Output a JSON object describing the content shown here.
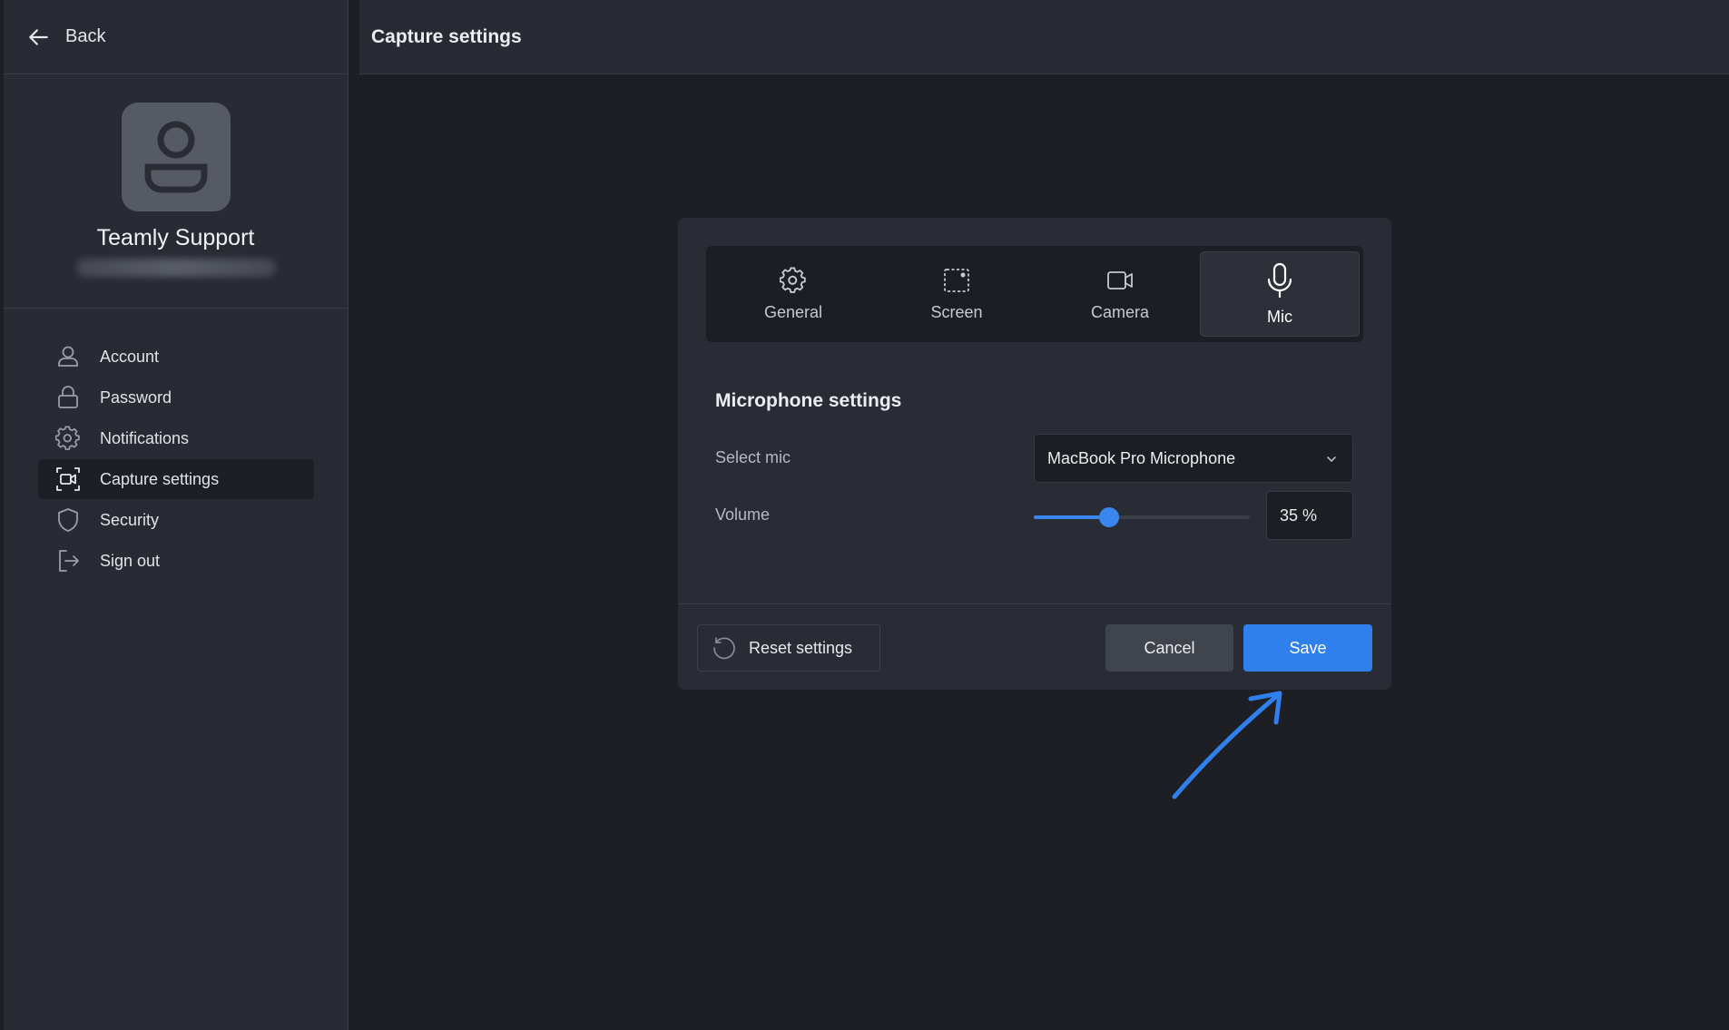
{
  "sidebar": {
    "back_label": "Back",
    "profile": {
      "name": "Teamly Support"
    },
    "items": [
      {
        "label": "Account",
        "icon": "user-icon",
        "active": false
      },
      {
        "label": "Password",
        "icon": "lock-icon",
        "active": false
      },
      {
        "label": "Notifications",
        "icon": "gear-icon",
        "active": false
      },
      {
        "label": "Capture settings",
        "icon": "capture-icon",
        "active": true
      },
      {
        "label": "Security",
        "icon": "shield-icon",
        "active": false
      },
      {
        "label": "Sign out",
        "icon": "sign-out-icon",
        "active": false
      }
    ]
  },
  "header": {
    "title": "Capture settings"
  },
  "dialog": {
    "tabs": [
      {
        "label": "General",
        "icon": "gear-icon"
      },
      {
        "label": "Screen",
        "icon": "screen-capture-icon"
      },
      {
        "label": "Camera",
        "icon": "camera-icon"
      },
      {
        "label": "Mic",
        "icon": "microphone-icon",
        "active": true
      }
    ],
    "section_title": "Microphone settings",
    "select_mic": {
      "label": "Select mic",
      "value": "MacBook Pro Microphone"
    },
    "volume": {
      "label": "Volume",
      "value": 35,
      "display": "35 %"
    },
    "buttons": {
      "reset": "Reset settings",
      "cancel": "Cancel",
      "save": "Save"
    }
  },
  "colors": {
    "accent": "#2f80ed",
    "background": "#1d1f25",
    "panel": "#282b33"
  }
}
